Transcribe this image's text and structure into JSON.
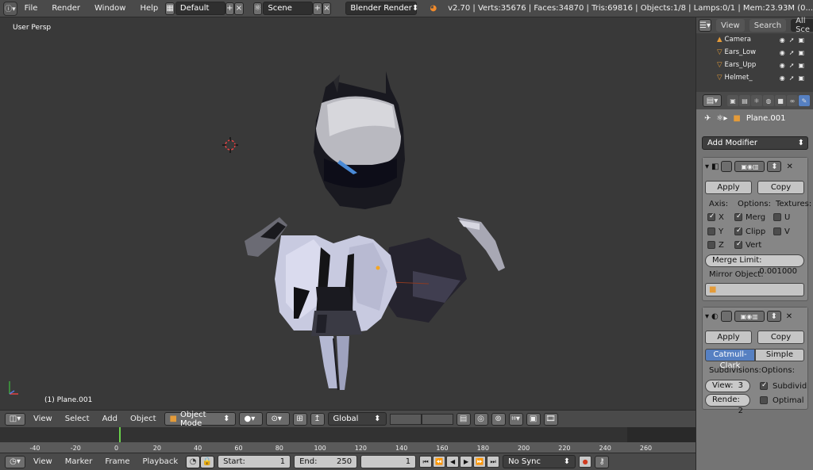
{
  "topbar": {
    "menus": [
      "File",
      "Render",
      "Window",
      "Help"
    ],
    "screen_layout": "Default",
    "scene": "Scene",
    "render_engine": "Blender Render",
    "stats": "v2.70 | Verts:35676 | Faces:34870 | Tris:69816 | Objects:1/8 | Lamps:0/1 | Mem:23.93M (0..."
  },
  "viewport": {
    "label": "User Persp",
    "object_label": "(1) Plane.001"
  },
  "outliner": {
    "tabs": [
      "View",
      "Search",
      "All Sce"
    ],
    "rows": [
      "Camera",
      "Ears_Low",
      "Ears_Upp",
      "Helmet_"
    ]
  },
  "properties": {
    "object_name": "Plane.001",
    "add_modifier": "Add Modifier",
    "mirror": {
      "apply": "Apply",
      "copy": "Copy",
      "axis": "Axis:",
      "options": "Options:",
      "textures": "Textures:",
      "x": "X",
      "y": "Y",
      "z": "Z",
      "merge": "Merg",
      "clipping": "Clipp",
      "vertex": "Vert",
      "u": "U",
      "v": "V",
      "merge_limit_label": "Merge Limit:",
      "merge_limit_value": "0.001000",
      "mirror_object": "Mirror Object:"
    },
    "subsurf": {
      "apply": "Apply",
      "copy": "Copy",
      "catmull": "Catmull-Clark",
      "simple": "Simple",
      "subdivisions": "Subdivisions:",
      "options": "Options:",
      "view_label": "View:",
      "view_value": "3",
      "render_label": "Rende:",
      "render_value": "2",
      "subdivide": "Subdivid",
      "optimal": "Optimal"
    }
  },
  "view3d_header": {
    "menus": [
      "View",
      "Select",
      "Add",
      "Object"
    ],
    "mode": "Object Mode",
    "orientation": "Global"
  },
  "timeline": {
    "ticks": [
      "-40",
      "-20",
      "0",
      "20",
      "40",
      "60",
      "80",
      "100",
      "120",
      "140",
      "160",
      "180",
      "200",
      "220",
      "240",
      "260"
    ]
  },
  "timeline_header": {
    "menus": [
      "View",
      "Marker",
      "Frame",
      "Playback"
    ],
    "start_label": "Start:",
    "start_value": "1",
    "end_label": "End:",
    "end_value": "250",
    "current_frame": "1",
    "sync": "No Sync"
  }
}
